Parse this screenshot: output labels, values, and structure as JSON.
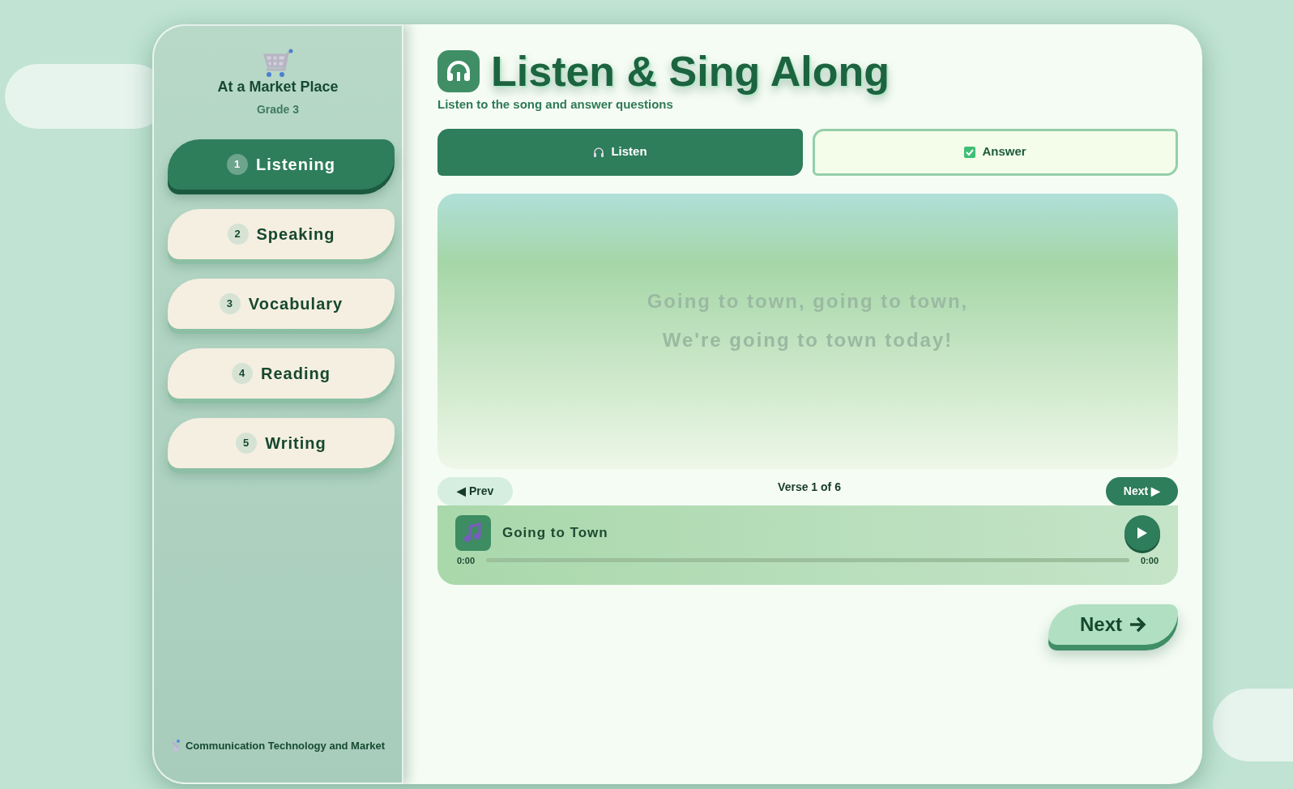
{
  "sidebar": {
    "title": "At a Market Place",
    "subtitle": "Grade 3",
    "items": [
      {
        "number": "1",
        "label": "Listening",
        "selected": true
      },
      {
        "number": "2",
        "label": "Speaking",
        "selected": false
      },
      {
        "number": "3",
        "label": "Vocabulary",
        "selected": false
      },
      {
        "number": "4",
        "label": "Reading",
        "selected": false
      },
      {
        "number": "5",
        "label": "Writing",
        "selected": false
      }
    ],
    "footer": "Communication Technology and Market"
  },
  "header": {
    "title": "Listen & Sing Along",
    "subtitle": "Listen to the song and answer questions"
  },
  "tabs": [
    {
      "kind": "listen",
      "label": "Listen",
      "selected": true
    },
    {
      "kind": "answer",
      "label": "Answer",
      "selected": false
    }
  ],
  "lyrics": [
    "Going to town, going to town,",
    "We're going to town today!"
  ],
  "verse_nav": {
    "prev": "◀ Prev",
    "counter": "Verse 1 of 6",
    "next": "Next ▶"
  },
  "player": {
    "track": "Going to Town",
    "current_time": "0:00",
    "duration": "0:00",
    "level": 0
  },
  "next_button": "Next"
}
